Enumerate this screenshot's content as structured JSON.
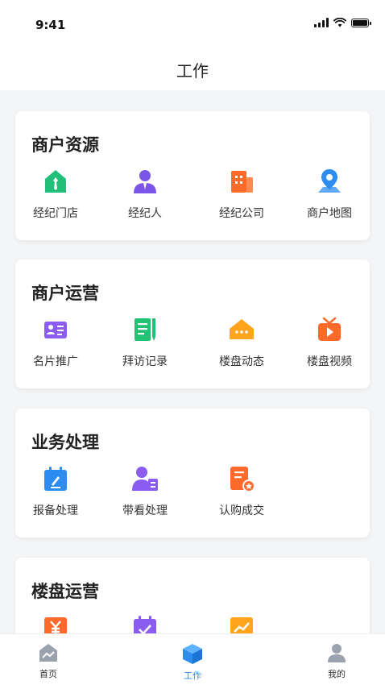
{
  "status": {
    "time": "9:41"
  },
  "header": {
    "title": "工作"
  },
  "sections": [
    {
      "title": "商户资源",
      "items": [
        {
          "label": "经纪门店",
          "icon": "store-icon",
          "color": "#21c07a"
        },
        {
          "label": "经纪人",
          "icon": "agent-icon",
          "color": "#7b55e8"
        },
        {
          "label": "经纪公司",
          "icon": "company-building-icon",
          "color": "#ff6a2a"
        },
        {
          "label": "商户地图",
          "icon": "map-pin-icon",
          "color": "#2d8cf0"
        }
      ]
    },
    {
      "title": "商户运营",
      "items": [
        {
          "label": "名片推广",
          "icon": "business-card-icon",
          "color": "#8a5cf0"
        },
        {
          "label": "拜访记录",
          "icon": "notepad-pen-icon",
          "color": "#22c275"
        },
        {
          "label": "楼盘动态",
          "icon": "house-chat-icon",
          "color": "#ffa41b"
        },
        {
          "label": "楼盘视频",
          "icon": "tv-play-icon",
          "color": "#ff6a2a"
        }
      ]
    },
    {
      "title": "业务处理",
      "items": [
        {
          "label": "报备处理",
          "icon": "calendar-edit-icon",
          "color": "#2d8cf0"
        },
        {
          "label": "带看处理",
          "icon": "user-card-icon",
          "color": "#8a5cf0"
        },
        {
          "label": "认购成交",
          "icon": "document-badge-icon",
          "color": "#ff6a2a"
        }
      ]
    },
    {
      "title": "楼盘运营",
      "items": [
        {
          "label": "",
          "icon": "yuan-icon",
          "color": "#ff6a2a"
        },
        {
          "label": "",
          "icon": "calendar-check-icon",
          "color": "#8a5cf0"
        },
        {
          "label": "",
          "icon": "trend-chart-icon",
          "color": "#ffa41b"
        }
      ]
    }
  ],
  "tabbar": {
    "tabs": [
      {
        "label": "首页",
        "icon": "home-chart-icon",
        "active": false
      },
      {
        "label": "工作",
        "icon": "cube-icon",
        "active": true
      },
      {
        "label": "我的",
        "icon": "person-icon",
        "active": false
      }
    ]
  }
}
